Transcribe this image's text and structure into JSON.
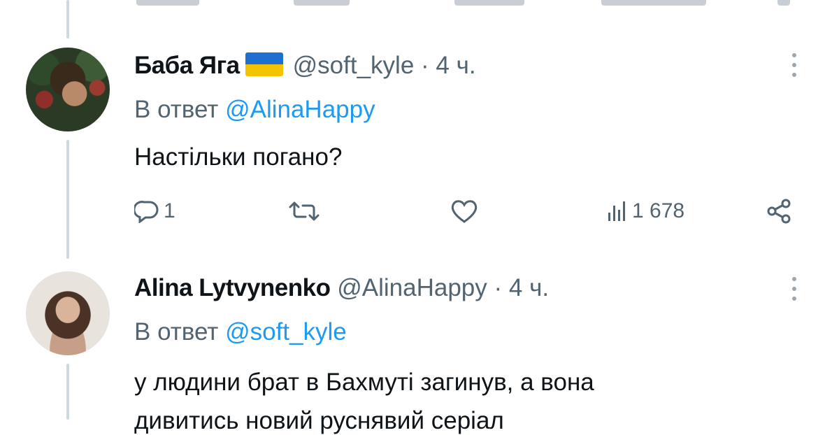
{
  "tweet1": {
    "display_name": "Баба Яга",
    "handle": "@soft_kyle",
    "separator": "·",
    "time": "4 ч.",
    "reply_prefix": "В ответ",
    "reply_to": "@AlinaHappy",
    "text": "Настільки погано?",
    "replies": "1",
    "views": "1 678",
    "flag_icon": "ukraine-flag-icon"
  },
  "tweet2": {
    "display_name": "Alina Lytvynenko",
    "handle": "@AlinaHappy",
    "separator": "·",
    "time": "4 ч.",
    "reply_prefix": "В ответ",
    "reply_to": "@soft_kyle",
    "text_line1": "у людини брат в Бахмуті загинув, а вона",
    "text_line2": "дивитись новий руснявий серіал"
  },
  "colors": {
    "text": "#0f1419",
    "muted": "#536471",
    "link": "#1d9bf0",
    "thread_line": "#cfd9de"
  }
}
